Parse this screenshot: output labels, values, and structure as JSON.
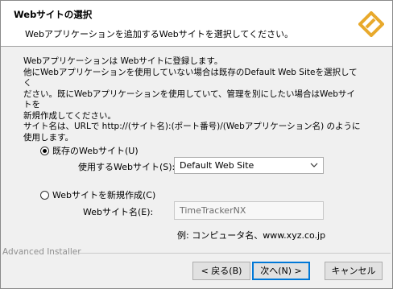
{
  "header": {
    "title": "Webサイトの選択",
    "subtitle": "Webアプリケーションを追加するWebサイトを選択してください。"
  },
  "description": {
    "line1": "Webアプリケーションは Webサイトに登録します。",
    "line2": "他にWebアプリケーションを使用していない場合は既存のDefault Web Siteを選択してく",
    "line3": "ださい。既にWebアプリケーションを使用していて、管理を別にしたい場合はWebサイトを",
    "line4": "新規作成してください。",
    "line5": "サイト名は、URLで http://(サイト名):(ポート番号)/(Webアプリケーション名) のように",
    "line6": "使用します。"
  },
  "existing": {
    "radio_label": "既存のWebサイト(U)",
    "selected": true,
    "field_label": "使用するWebサイト(S):",
    "select_value": "Default Web Site"
  },
  "new_site": {
    "radio_label": "Webサイトを新規作成(C)",
    "selected": false,
    "field_label": "Webサイト名(E):",
    "input_placeholder": "TimeTrackerNX",
    "example": "例: コンピュータ名、www.xyz.co.jp"
  },
  "footer": {
    "brand": "Advanced Installer",
    "back_label": "< 戻る(B)",
    "next_label": "次へ(N) >",
    "cancel_label": "キャンセル"
  },
  "colors": {
    "logo": "#e8a92c",
    "default_button_border": "#0078d7"
  },
  "icons": {
    "logo": "advanced-installer-logo-icon",
    "dropdown": "chevron-down-icon"
  }
}
